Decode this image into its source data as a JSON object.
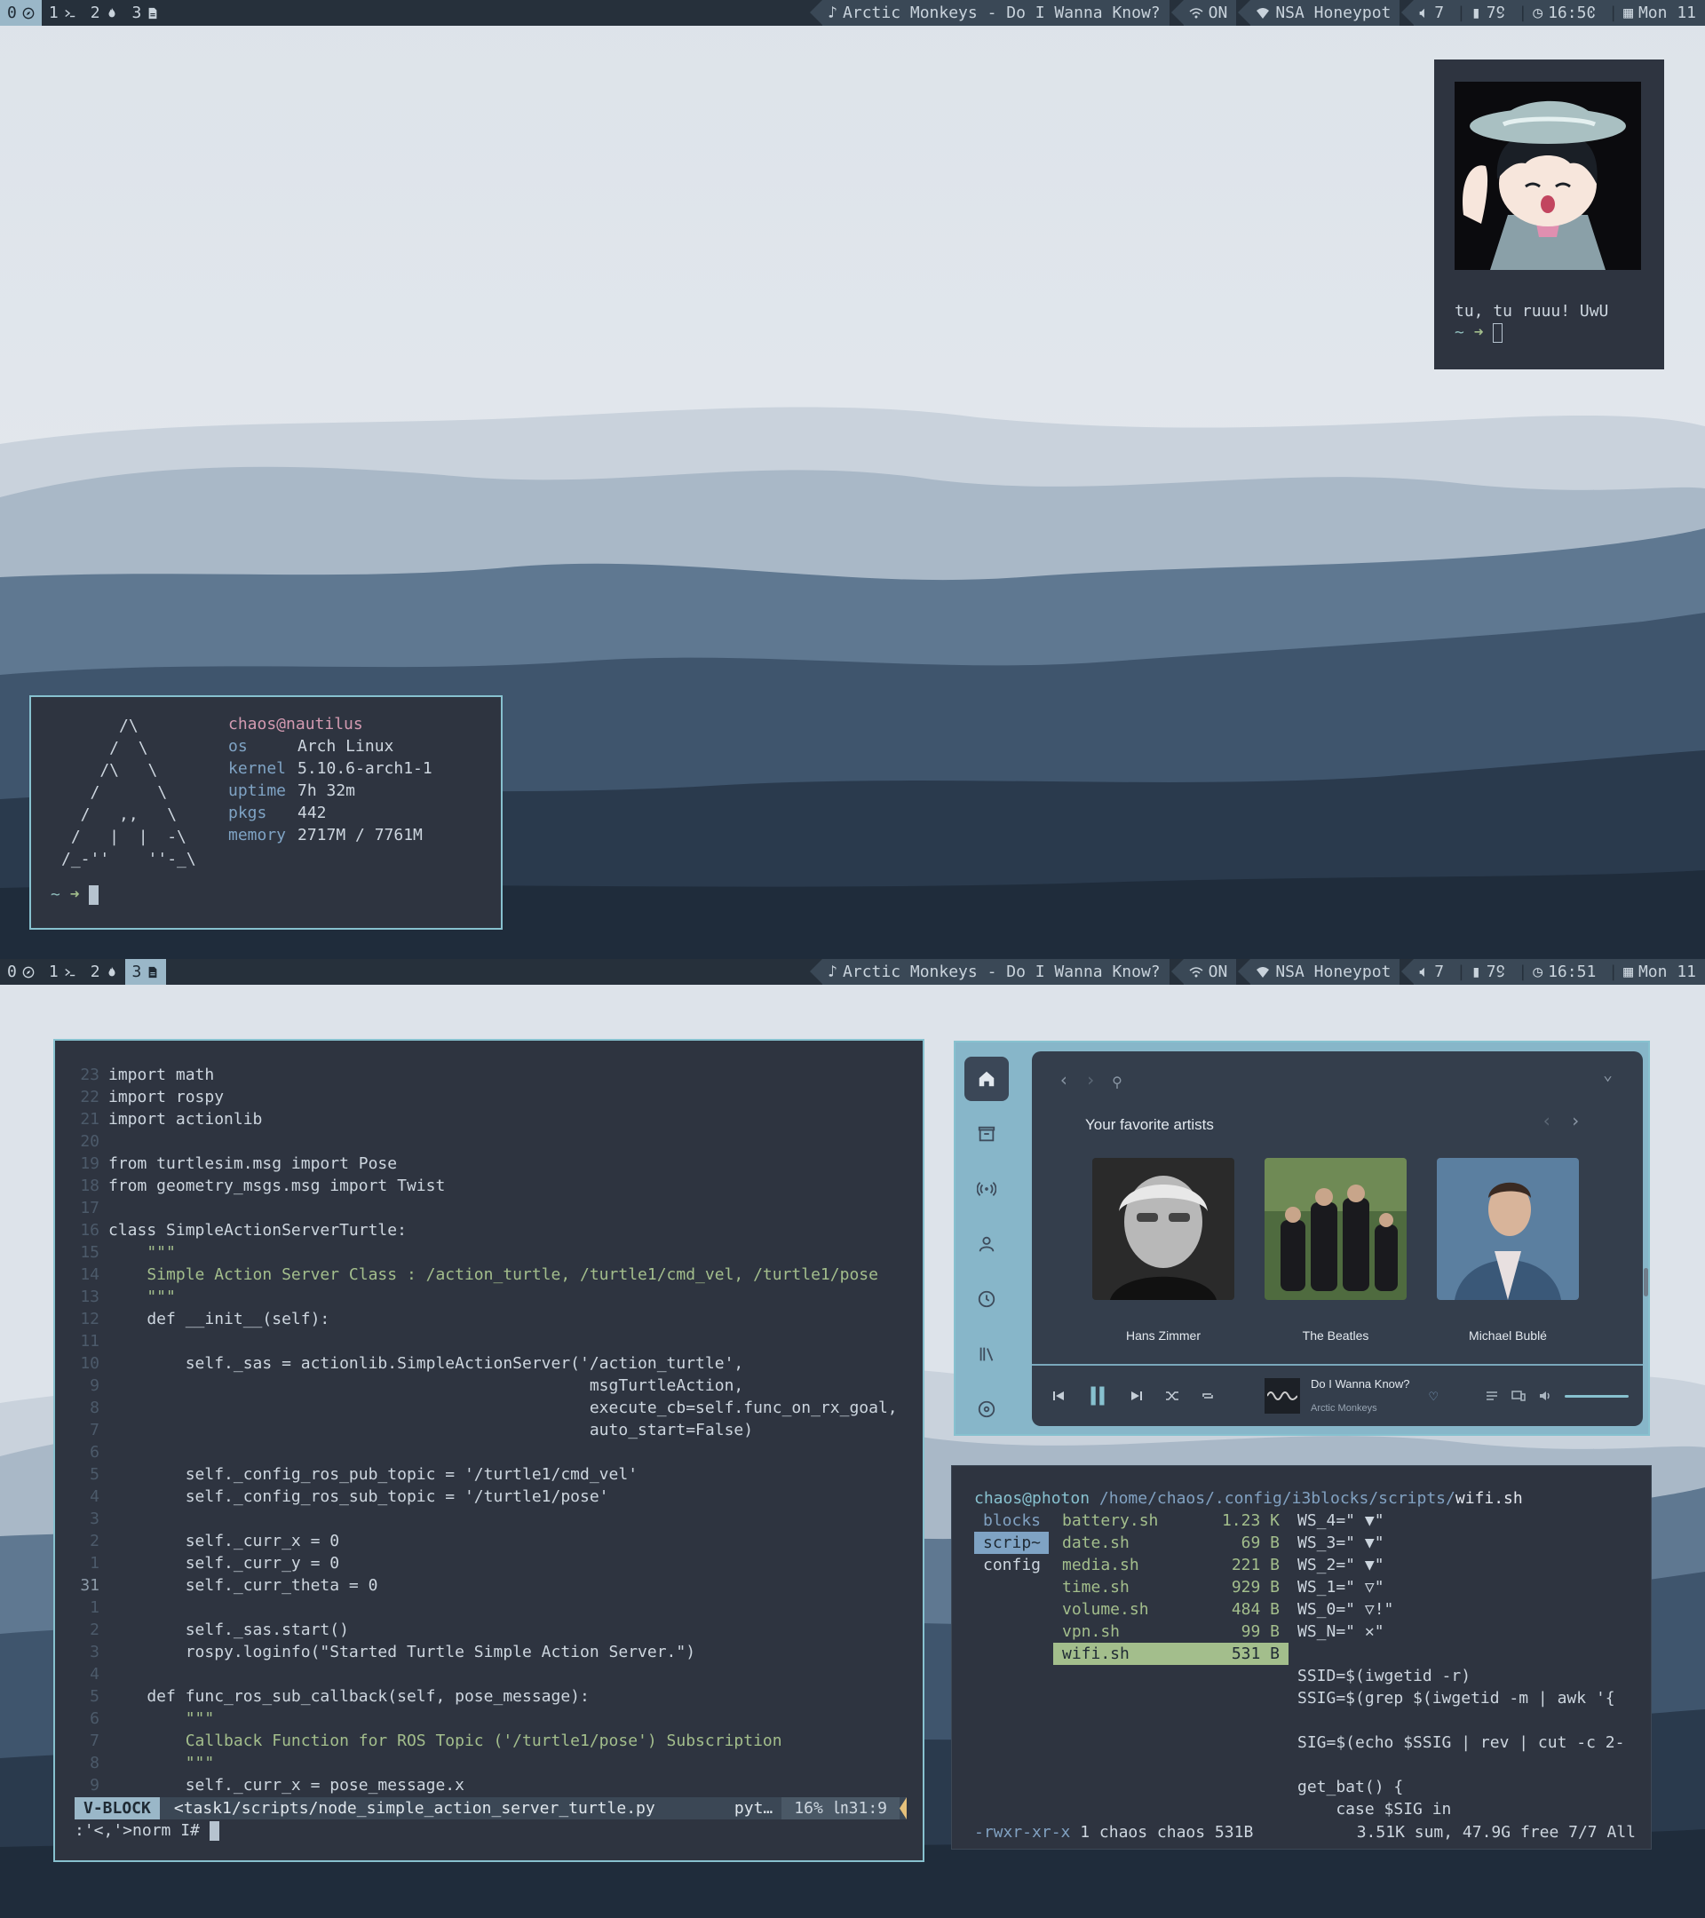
{
  "bar_top": {
    "workspaces": [
      {
        "num": "0",
        "icon": "compass-icon",
        "active": true
      },
      {
        "num": "1",
        "icon": "terminal-icon",
        "active": false
      },
      {
        "num": "2",
        "icon": "fire-icon",
        "active": false
      },
      {
        "num": "3",
        "icon": "document-icon",
        "active": false
      }
    ],
    "media": "Arctic Monkeys - Do I Wanna Know?",
    "vpn": "ON",
    "wifi": "NSA Honeypot",
    "volume": "7",
    "battery": "79",
    "time": "16:50",
    "date": "Mon 11"
  },
  "bar_bottom": {
    "workspaces": [
      {
        "num": "0",
        "icon": "compass-icon",
        "active": false
      },
      {
        "num": "1",
        "icon": "terminal-icon",
        "active": false
      },
      {
        "num": "2",
        "icon": "fire-icon",
        "active": false
      },
      {
        "num": "3",
        "icon": "document-icon",
        "active": true
      }
    ],
    "media": "Arctic Monkeys - Do I Wanna Know?",
    "vpn": "ON",
    "wifi": "NSA Honeypot",
    "volume": "7",
    "battery": "79",
    "time": "16:51",
    "date": "Mon 11"
  },
  "mascot_terminal": {
    "caption": "tu, tu ruuu! UwU",
    "prompt_tilde": "~",
    "prompt_arrow": "➜"
  },
  "fetch": {
    "ascii": "      /\\\n     /  \\\n    /\\   \\\n   /      \\\n  /   ,,   \\\n /   |  |  -\\\n/_-''    ''-_\\",
    "userhost": "chaos@nautilus",
    "rows": [
      {
        "key": "os",
        "value": "Arch Linux"
      },
      {
        "key": "kernel",
        "value": "5.10.6-arch1-1"
      },
      {
        "key": "uptime",
        "value": "7h 32m"
      },
      {
        "key": "pkgs",
        "value": "442"
      },
      {
        "key": "memory",
        "value": "2717M / 7761M"
      }
    ],
    "prompt_tilde": "~",
    "prompt_arrow": "➜"
  },
  "vim": {
    "lines": [
      {
        "n": "23",
        "t": "import math"
      },
      {
        "n": "22",
        "t": "import rospy"
      },
      {
        "n": "21",
        "t": "import actionlib"
      },
      {
        "n": "20",
        "t": ""
      },
      {
        "n": "19",
        "t": "from turtlesim.msg import Pose"
      },
      {
        "n": "18",
        "t": "from geometry_msgs.msg import Twist"
      },
      {
        "n": "17",
        "t": ""
      },
      {
        "n": "16",
        "t": "class SimpleActionServerTurtle:"
      },
      {
        "n": "15",
        "t": "    \"\"\""
      },
      {
        "n": "14",
        "t": "    Simple Action Server Class : /action_turtle, /turtle1/cmd_vel, /turtle1/pose"
      },
      {
        "n": "13",
        "t": "    \"\"\""
      },
      {
        "n": "12",
        "t": "    def __init__(self):"
      },
      {
        "n": "11",
        "t": ""
      },
      {
        "n": "10",
        "t": "        self._sas = actionlib.SimpleActionServer('/action_turtle',"
      },
      {
        "n": "9",
        "t": "                                                  msgTurtleAction,"
      },
      {
        "n": "8",
        "t": "                                                  execute_cb=self.func_on_rx_goal,"
      },
      {
        "n": "7",
        "t": "                                                  auto_start=False)"
      },
      {
        "n": "6",
        "t": ""
      },
      {
        "n": "5",
        "t": "        self._config_ros_pub_topic = '/turtle1/cmd_vel'"
      },
      {
        "n": "4",
        "t": "        self._config_ros_sub_topic = '/turtle1/pose'"
      },
      {
        "n": "3",
        "t": ""
      },
      {
        "n": "2",
        "t": "        self._curr_x = 0"
      },
      {
        "n": "1",
        "t": "        self._curr_y = 0"
      },
      {
        "n": "31",
        "t": "        self._curr_theta = 0"
      },
      {
        "n": "1",
        "t": ""
      },
      {
        "n": "2",
        "t": "        self._sas.start()"
      },
      {
        "n": "3",
        "t": "        rospy.loginfo(\"Started Turtle Simple Action Server.\")"
      },
      {
        "n": "4",
        "t": ""
      },
      {
        "n": "5",
        "t": "    def func_ros_sub_callback(self, pose_message):"
      },
      {
        "n": "6",
        "t": "        \"\"\""
      },
      {
        "n": "7",
        "t": "        Callback Function for ROS Topic ('/turtle1/pose') Subscription"
      },
      {
        "n": "8",
        "t": "        \"\"\""
      },
      {
        "n": "9",
        "t": "        self._curr_x = pose_message.x"
      }
    ],
    "mode": "V-BLOCK",
    "file": "<task1/scripts/node_simple_action_server_turtle.py",
    "filetype": "pyt…",
    "percent": "16%",
    "position": "31:9",
    "cmdline": ":'<,'>norm I#"
  },
  "music": {
    "section_title": "Your favorite artists",
    "artists": [
      {
        "name": "Hans Zimmer"
      },
      {
        "name": "The Beatles"
      },
      {
        "name": "Michael Bublé"
      }
    ],
    "now_playing": {
      "title": "Do I Wanna Know?",
      "artist": "Arctic Monkeys"
    }
  },
  "ranger": {
    "user": "chaos@photon",
    "path": "/home/chaos/.config/i3blocks/scripts/",
    "file": "wifi.sh",
    "parent": [
      {
        "name": "blocks",
        "selected": false
      },
      {
        "name": "scrip~",
        "selected": true
      },
      {
        "name": "config",
        "selected": false
      }
    ],
    "files": [
      {
        "name": "battery.sh",
        "size": "1.23 K",
        "selected": false
      },
      {
        "name": "date.sh",
        "size": "69 B",
        "selected": false
      },
      {
        "name": "media.sh",
        "size": "221 B",
        "selected": false
      },
      {
        "name": "time.sh",
        "size": "929 B",
        "selected": false
      },
      {
        "name": "volume.sh",
        "size": "484 B",
        "selected": false
      },
      {
        "name": "vpn.sh",
        "size": "99 B",
        "selected": false
      },
      {
        "name": "wifi.sh",
        "size": "531 B",
        "selected": true
      }
    ],
    "preview": [
      "WS_4=\" ▼\"",
      "WS_3=\" ▼\"",
      "WS_2=\" ▼\"",
      "WS_1=\" ▽\"",
      "WS_0=\" ▽!\"",
      "WS_N=\" ✕\"",
      "",
      "SSID=$(iwgetid -r)",
      "SSIG=$(grep $(iwgetid -m | awk '{",
      "",
      "SIG=$(echo $SSIG | rev | cut -c 2-",
      "",
      "get_bat() {",
      "    case $SIG in"
    ],
    "perms": "-rwxr-xr-x",
    "owner": "1 chaos chaos 531B",
    "summary": "3.51K sum, 47.9G free  7/7  All"
  }
}
